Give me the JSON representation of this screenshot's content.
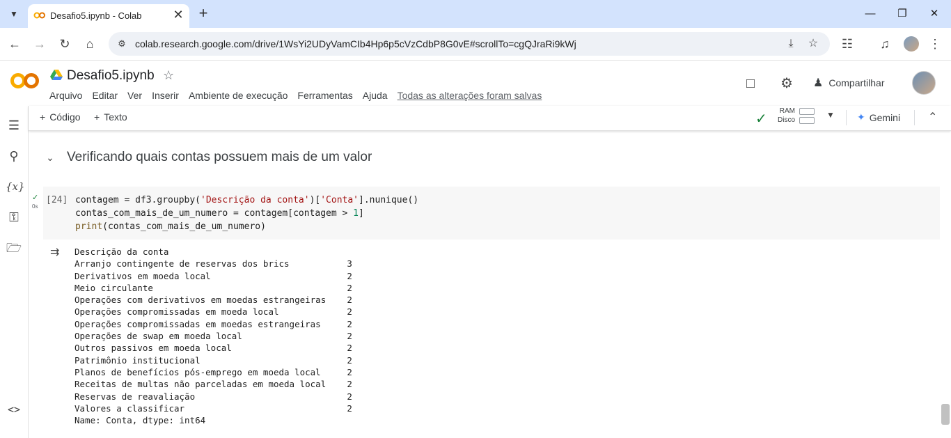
{
  "browser": {
    "tab_title": "Desafio5.ipynb - Colab",
    "tab_close": "✕",
    "new_tab": "+",
    "url": "colab.research.google.com/drive/1WsYi2UDyVamCIb4Hp6p5cVzCdbP8G0vE#scrollTo=cgQJraRi9kWj"
  },
  "colab": {
    "notebook_title": "Desafio5.ipynb",
    "menu": [
      "Arquivo",
      "Editar",
      "Ver",
      "Inserir",
      "Ambiente de execução",
      "Ferramentas",
      "Ajuda"
    ],
    "saved_status": "Todas as alterações foram salvas",
    "share_label": "Compartilhar"
  },
  "cell_toolbar": {
    "add_code": "Código",
    "add_text": "Texto",
    "ram_label": "RAM",
    "disk_label": "Disco",
    "gemini_label": "Gemini"
  },
  "notebook": {
    "section_title": "Verificando quais contas possuem mais de um valor",
    "cell": {
      "exec_count": "[24]",
      "run_time": "0s",
      "code_lines": [
        "contagem = df3.groupby('Descrição da conta')['Conta'].nunique()",
        "contas_com_mais_de_um_numero = contagem[contagem > 1]",
        "print(contas_com_mais_de_um_numero)"
      ]
    },
    "output": {
      "header": "Descrição da conta",
      "rows": [
        {
          "name": "Arranjo contingente de reservas dos brics",
          "value": "3"
        },
        {
          "name": "Derivativos em moeda local",
          "value": "2"
        },
        {
          "name": "Meio circulante",
          "value": "2"
        },
        {
          "name": "Operações com derivativos em moedas estrangeiras",
          "value": "2"
        },
        {
          "name": "Operações compromissadas em moeda local",
          "value": "2"
        },
        {
          "name": "Operações compromissadas em moedas estrangeiras",
          "value": "2"
        },
        {
          "name": "Operações de swap em moeda local",
          "value": "2"
        },
        {
          "name": "Outros passivos em moeda local",
          "value": "2"
        },
        {
          "name": "Patrimônio institucional",
          "value": "2"
        },
        {
          "name": "Planos de benefícios pós-emprego em moeda local",
          "value": "2"
        },
        {
          "name": "Receitas de multas não parceladas em moeda local",
          "value": "2"
        },
        {
          "name": "Reservas de reavaliação",
          "value": "2"
        },
        {
          "name": "Valores a classificar",
          "value": "2"
        }
      ],
      "footer": "Name: Conta, dtype: int64"
    }
  },
  "colors": {
    "tabbar_bg": "#d3e3fd",
    "accent_green": "#188038",
    "colab_orange": "#f9ab00"
  }
}
